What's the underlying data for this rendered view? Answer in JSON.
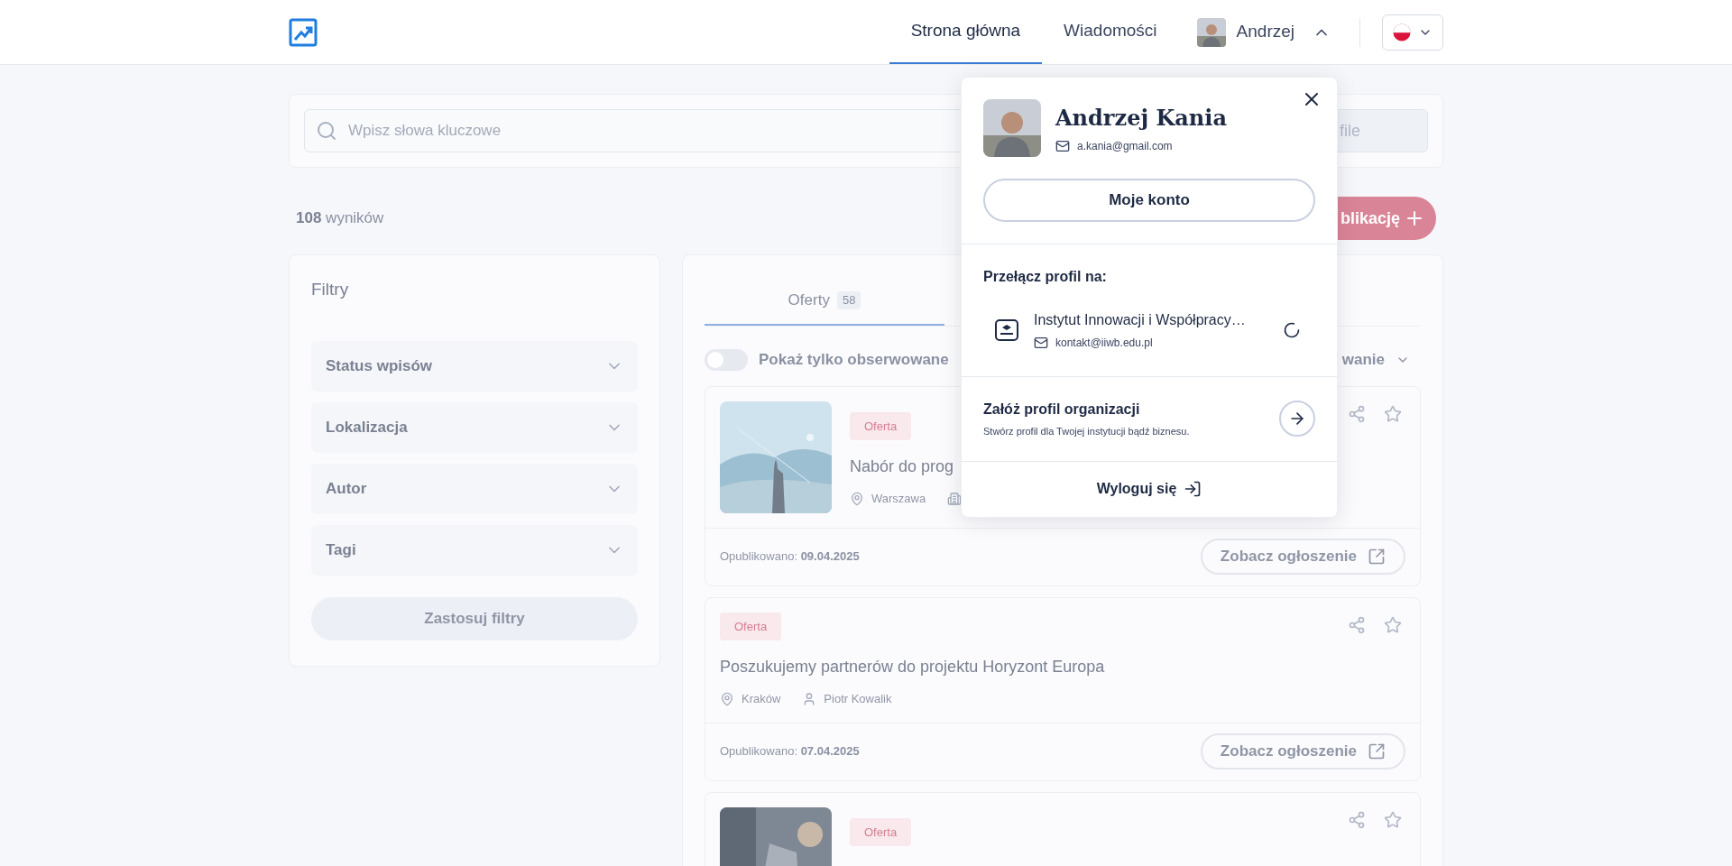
{
  "header": {
    "nav": [
      {
        "label": "Strona główna",
        "selected": true
      },
      {
        "label": "Wiadomości",
        "selected": false
      }
    ],
    "user": {
      "name": "Andrzej",
      "expanded": true
    }
  },
  "search": {
    "placeholder": "Wpisz słowa kluczowe",
    "button": "file"
  },
  "results": {
    "count": "108",
    "label": "wyników"
  },
  "add_button": "blikację",
  "filters": {
    "title": "Filtry",
    "items": [
      "Status wpisów",
      "Lokalizacja",
      "Autor",
      "Tagi"
    ],
    "apply": {
      "label": "Zastosuj filtry",
      "disabled": true
    }
  },
  "tabs": [
    {
      "label": "Oferty",
      "count": "58",
      "selected": true
    }
  ],
  "toggle": {
    "label": "Pokaż tylko obserwowane",
    "on": false
  },
  "sort": "wanie",
  "cards": [
    {
      "tag": "Oferta",
      "title": "Nabór do prog",
      "meta": [
        {
          "kind": "location",
          "text": "Warszawa"
        },
        {
          "kind": "organization"
        }
      ],
      "published_label": "Opublikowano:",
      "date": "09.04.2025",
      "button": "Zobacz ogłoszenie"
    },
    {
      "kind": "text",
      "tag": "Oferta",
      "title": "Poszukujemy partnerów do projektu Horyzont Europa",
      "meta": [
        {
          "kind": "location",
          "text": "Kraków"
        },
        {
          "kind": "person",
          "text": "Piotr Kowalik"
        }
      ],
      "published_label": "Opublikowano:",
      "date": "07.04.2025",
      "button": "Zobacz ogłoszenie"
    },
    {
      "tag": "Oferta"
    }
  ],
  "menu": {
    "name": "Andrzej Kania",
    "email": "a.kania@gmail.com",
    "account_button": "Moje konto",
    "switch_label": "Przełącz profil na:",
    "profiles": [
      {
        "name": "Instytut Innowacji i Współpracy…",
        "email": "kontakt@iiwb.edu.pl",
        "loading": true
      }
    ],
    "create": {
      "title": "Załóż profil organizacji",
      "subtitle": "Stwórz profil dla Twojej instytucji bądź biznesu."
    },
    "logout": "Wyloguj się"
  }
}
